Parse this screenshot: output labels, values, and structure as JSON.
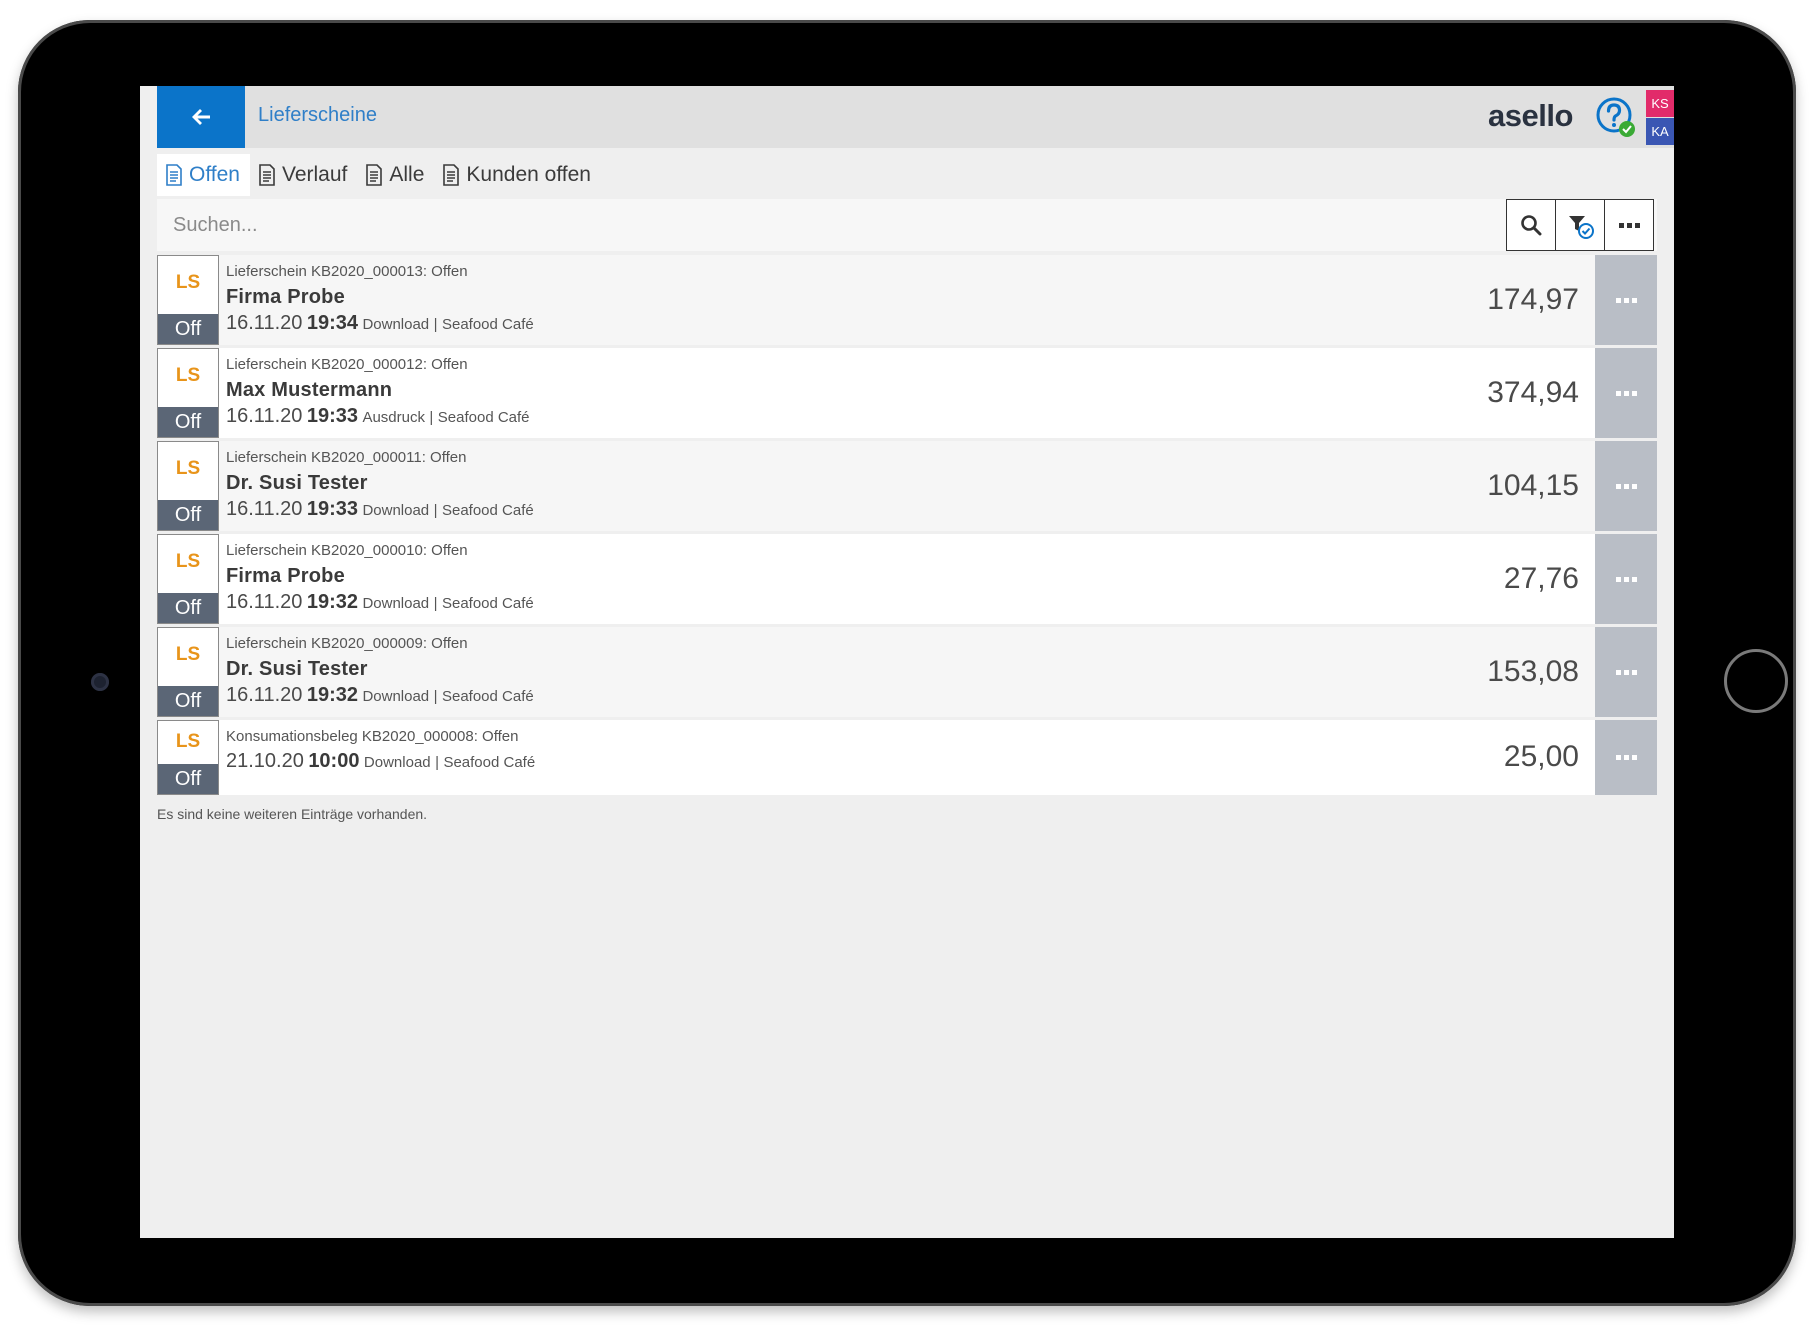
{
  "header": {
    "title": "Lieferscheine",
    "brand": "asello",
    "badges": [
      "KS",
      "KA"
    ]
  },
  "tabs": [
    {
      "label": "Offen",
      "active": true
    },
    {
      "label": "Verlauf",
      "active": false
    },
    {
      "label": "Alle",
      "active": false
    },
    {
      "label": "Kunden offen",
      "active": false
    }
  ],
  "search": {
    "placeholder": "Suchen...",
    "value": ""
  },
  "status": {
    "ls": "LS",
    "off": "Off"
  },
  "rows": [
    {
      "doc": "Lieferschein KB2020_000013: Offen",
      "customer": "Firma Probe",
      "date": "16.11.20",
      "time": "19:34",
      "mode": "Download",
      "sep": "|",
      "location": "Seafood Café",
      "amount": "174,97"
    },
    {
      "doc": "Lieferschein KB2020_000012: Offen",
      "customer": "Max Mustermann",
      "date": "16.11.20",
      "time": "19:33",
      "mode": "Ausdruck",
      "sep": "|",
      "location": "Seafood Café",
      "amount": "374,94"
    },
    {
      "doc": "Lieferschein KB2020_000011: Offen",
      "customer": "Dr. Susi Tester",
      "date": "16.11.20",
      "time": "19:33",
      "mode": "Download",
      "sep": "|",
      "location": "Seafood Café",
      "amount": "104,15"
    },
    {
      "doc": "Lieferschein KB2020_000010: Offen",
      "customer": "Firma Probe",
      "date": "16.11.20",
      "time": "19:32",
      "mode": "Download",
      "sep": "|",
      "location": "Seafood Café",
      "amount": "27,76"
    },
    {
      "doc": "Lieferschein KB2020_000009: Offen",
      "customer": "Dr. Susi Tester",
      "date": "16.11.20",
      "time": "19:32",
      "mode": "Download",
      "sep": "|",
      "location": "Seafood Café",
      "amount": "153,08"
    },
    {
      "doc": "Konsumationsbeleg KB2020_000008: Offen",
      "date": "21.10.20",
      "time": "10:00",
      "mode": "Download",
      "sep": "|",
      "location": "Seafood Café",
      "amount": "25,00"
    }
  ],
  "footer": {
    "note": "Es sind keine weiteren Einträge vorhanden."
  },
  "colors": {
    "accent": "#0b74c9",
    "status_label": "#e8941a",
    "status_bg": "#5b6676",
    "ks": "#e22b6a",
    "ka": "#3a56b3"
  },
  "icons": [
    "arrow-left-icon",
    "help-icon",
    "check-icon",
    "document-icon",
    "search-icon",
    "filter-icon",
    "more-icon"
  ]
}
